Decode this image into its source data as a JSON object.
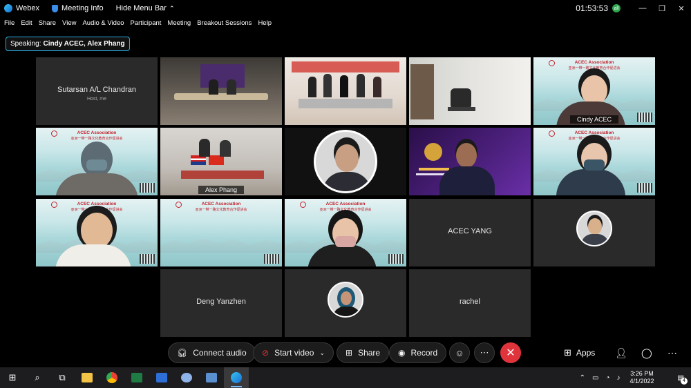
{
  "titlebar": {
    "app_name": "Webex",
    "meeting_info": "Meeting Info",
    "hide_menu_bar": "Hide Menu Bar",
    "clock": "01:53:53",
    "clock_badge": "all"
  },
  "menubar": [
    "File",
    "Edit",
    "Share",
    "View",
    "Audio & Video",
    "Participant",
    "Meeting",
    "Breakout Sessions",
    "Help"
  ],
  "speaking": {
    "label": "Speaking:",
    "names": "Cindy ACEC, Alex Phang"
  },
  "tiles": {
    "host": {
      "name": "Sutarsan A/L Chandran",
      "role": "Host, me"
    },
    "cindy": {
      "name": "Cindy ACEC"
    },
    "alex": {
      "name": "Alex Phang"
    },
    "acec_yang": {
      "name": "ACEC YANG"
    },
    "deng": {
      "name": "Deng Yanzhen"
    },
    "rachel": {
      "name": "rachel"
    },
    "banner_title": "ACEC Association",
    "banner_sub": "亚洲一带一路文化教育合作促进会"
  },
  "controls": {
    "connect_audio": "Connect audio",
    "start_video": "Start video",
    "share": "Share",
    "record": "Record",
    "apps": "Apps"
  },
  "taskbar": {
    "time": "3:26 PM",
    "date": "4/1/2022",
    "notifications": "4"
  },
  "colors": {
    "accent": "#27b1e6",
    "end_call": "#e0343c",
    "tile_bg": "#2a2a2a"
  }
}
